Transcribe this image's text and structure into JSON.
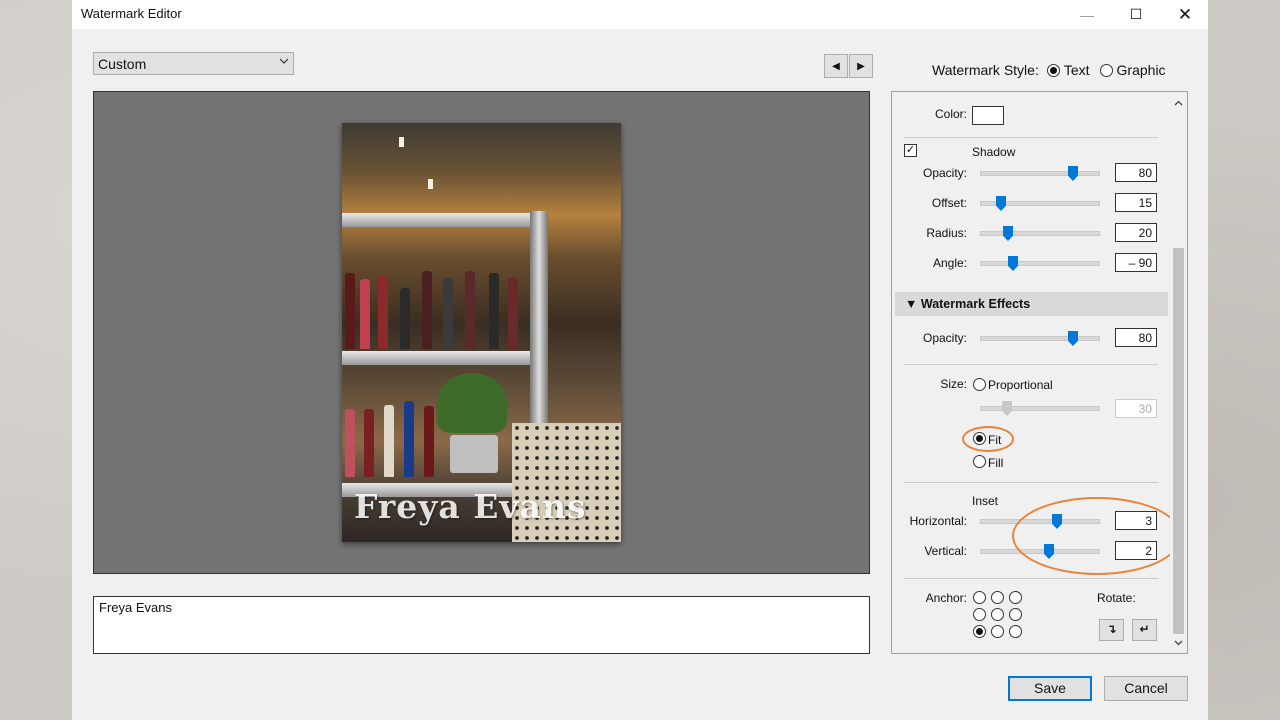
{
  "window": {
    "title": "Watermark Editor",
    "minimize_glyph": "—",
    "maximize_glyph": "☐",
    "close_glyph": "✕"
  },
  "toolbar": {
    "preset_value": "Custom",
    "prev_glyph": "◀",
    "next_glyph": "▶",
    "style_label": "Watermark Style:",
    "style_text": "Text",
    "style_graphic": "Graphic",
    "style_selected": "Text"
  },
  "preview": {
    "watermark_text": "Freya Evans"
  },
  "text_input": {
    "value": "Freya Evans"
  },
  "panel": {
    "color_label": "Color:",
    "color_value": "#ffffff",
    "shadow": {
      "label": "Shadow",
      "checked": true,
      "opacity_label": "Opacity:",
      "opacity": "80",
      "offset_label": "Offset:",
      "offset": "15",
      "radius_label": "Radius:",
      "radius": "20",
      "angle_label": "Angle:",
      "angle": "– 90"
    },
    "effects": {
      "header": "Watermark Effects",
      "opacity_label": "Opacity:",
      "opacity": "80",
      "size_label": "Size:",
      "proportional_label": "Proportional",
      "proportional_value": "30",
      "fit_label": "Fit",
      "fill_label": "Fill",
      "size_selected": "Fit",
      "inset_label": "Inset",
      "horizontal_label": "Horizontal:",
      "horizontal": "3",
      "vertical_label": "Vertical:",
      "vertical": "2",
      "anchor_label": "Anchor:",
      "anchor_selected": "bottom-left",
      "rotate_label": "Rotate:",
      "rotate_cw_glyph": "↴",
      "rotate_ccw_glyph": "↵"
    }
  },
  "footer": {
    "save_label": "Save",
    "cancel_label": "Cancel"
  },
  "colors": {
    "accent": "#0078d7",
    "annotation": "#e8843a"
  }
}
